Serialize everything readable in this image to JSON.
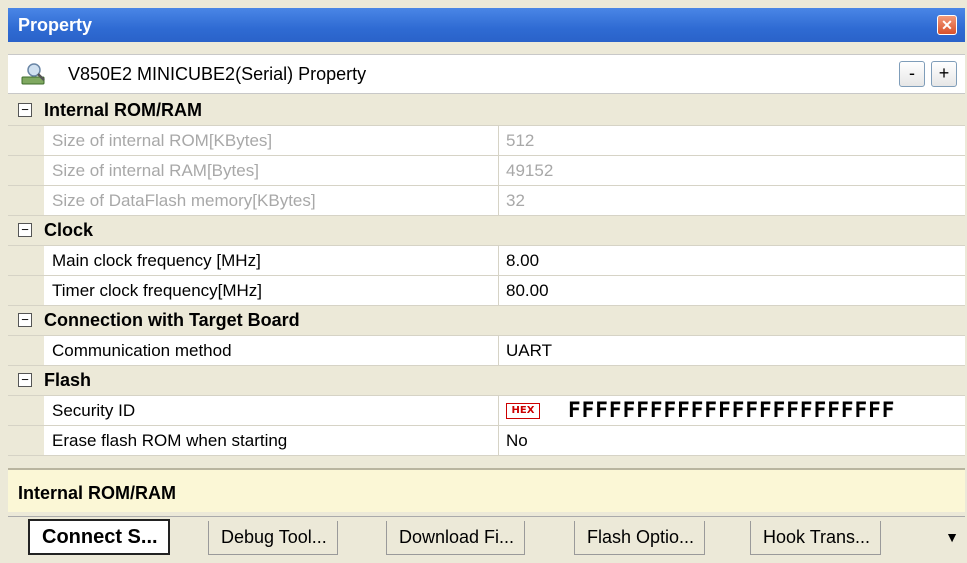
{
  "window": {
    "title": "Property",
    "close_label": "✕"
  },
  "header": {
    "title": "V850E2 MINICUBE2(Serial) Property",
    "collapse_label": "-",
    "expand_label": "+"
  },
  "categories": [
    {
      "label": "Internal ROM/RAM",
      "expanded": true,
      "rows": [
        {
          "name": "Size of internal ROM[KBytes]",
          "value": "512",
          "readonly": true
        },
        {
          "name": "Size of internal RAM[Bytes]",
          "value": "49152",
          "readonly": true
        },
        {
          "name": "Size of DataFlash memory[KBytes]",
          "value": "32",
          "readonly": true
        }
      ]
    },
    {
      "label": "Clock",
      "expanded": true,
      "rows": [
        {
          "name": "Main clock frequency [MHz]",
          "value": "8.00",
          "readonly": false
        },
        {
          "name": "Timer clock frequency[MHz]",
          "value": "80.00",
          "readonly": false
        }
      ]
    },
    {
      "label": "Connection with Target Board",
      "expanded": true,
      "rows": [
        {
          "name": "Communication method",
          "value": "UART",
          "readonly": false
        }
      ]
    },
    {
      "label": "Flash",
      "expanded": true,
      "rows": [
        {
          "name": "Security ID",
          "value": "FFFFFFFFFFFFFFFFFFFFFFFF",
          "hex_badge": "HEX",
          "readonly": false
        },
        {
          "name": "Erase flash ROM when starting",
          "value": "No",
          "readonly": false
        }
      ]
    }
  ],
  "toggle_symbol": "−",
  "description": "Internal ROM/RAM",
  "tabs": [
    {
      "label": "Connect S...",
      "active": true
    },
    {
      "label": "Debug Tool...",
      "active": false
    },
    {
      "label": "Download Fi...",
      "active": false
    },
    {
      "label": "Flash Optio...",
      "active": false
    },
    {
      "label": "Hook Trans...",
      "active": false
    }
  ],
  "tab_overflow": "▼",
  "colors": {
    "title_bar": "#2f6bd3",
    "category_bg": "#ece9d8",
    "description_bg": "#fbf7d6"
  }
}
